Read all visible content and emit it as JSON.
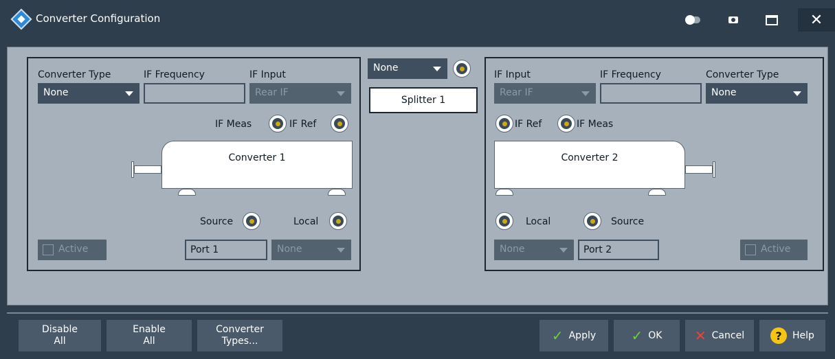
{
  "window": {
    "title": "Converter Configuration"
  },
  "left": {
    "converter_type_label": "Converter Type",
    "converter_type_value": "None",
    "if_frequency_label": "IF Frequency",
    "if_frequency_value": "",
    "if_input_label": "IF Input",
    "if_input_value": "Rear IF",
    "if_meas_label": "IF Meas",
    "if_ref_label": "IF Ref",
    "converter_name": "Converter 1",
    "source_label": "Source",
    "local_label": "Local",
    "active_label": "Active",
    "port_value": "Port 1",
    "local_select_value": "None"
  },
  "center": {
    "splitter_select_value": "None",
    "splitter_label": "Splitter 1"
  },
  "right": {
    "if_input_label": "IF Input",
    "if_input_value": "Rear IF",
    "if_frequency_label": "IF Frequency",
    "if_frequency_value": "",
    "converter_type_label": "Converter Type",
    "converter_type_value": "None",
    "if_ref_label": "IF Ref",
    "if_meas_label": "IF Meas",
    "converter_name": "Converter 2",
    "local_label": "Local",
    "source_label": "Source",
    "local_select_value": "None",
    "port_value": "Port 2",
    "active_label": "Active"
  },
  "buttons": {
    "disable_all_line1": "Disable",
    "disable_all_line2": "All",
    "enable_all_line1": "Enable",
    "enable_all_line2": "All",
    "converter_types_line1": "Converter",
    "converter_types_line2": "Types...",
    "apply": "Apply",
    "ok": "OK",
    "cancel": "Cancel",
    "help": "Help"
  },
  "colors": {
    "title_bar": "#2e3e4d",
    "panel_bg": "#a6b1bc",
    "control_dark": "#3f4f5f",
    "accent_check": "#6cd23c",
    "accent_cancel": "#e8453c",
    "accent_help": "#f4c514"
  }
}
